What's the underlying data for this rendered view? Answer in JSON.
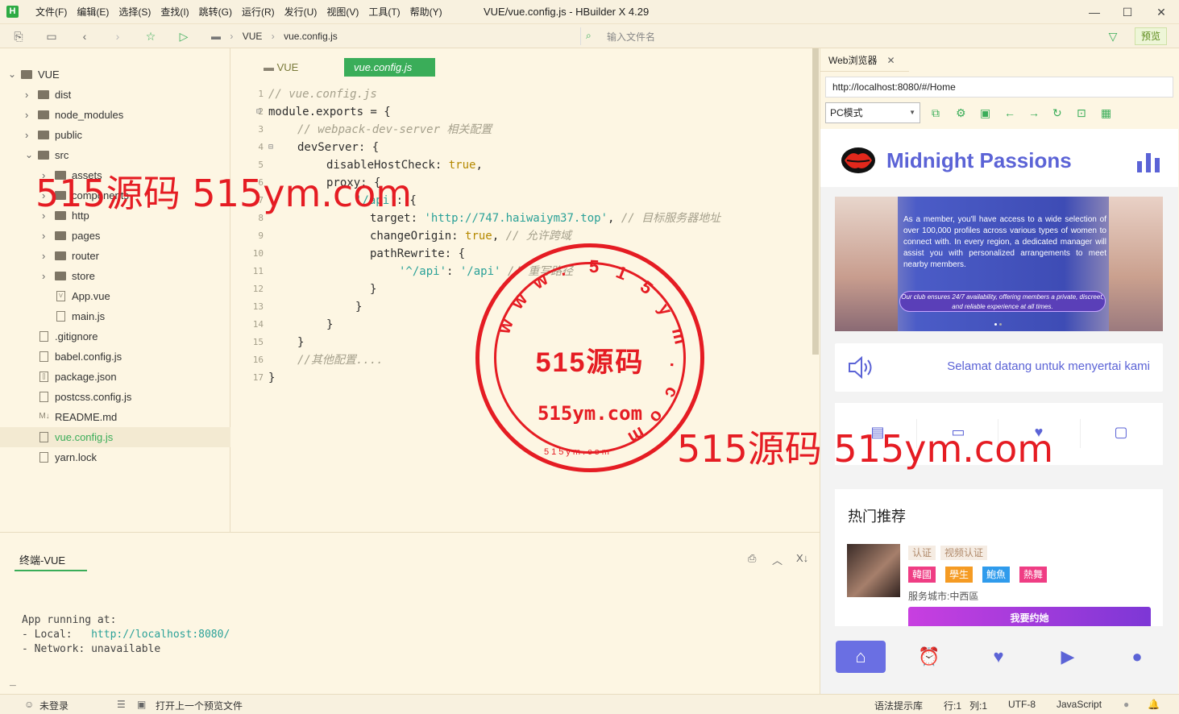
{
  "app": {
    "logo": "H",
    "window_title": "VUE/vue.config.js - HBuilder X 4.29",
    "menu": [
      "文件(F)",
      "编辑(E)",
      "选择(S)",
      "查找(I)",
      "跳转(G)",
      "运行(R)",
      "发行(U)",
      "视图(V)",
      "工具(T)",
      "帮助(Y)"
    ],
    "window_buttons": [
      "—",
      "☐",
      "✕"
    ]
  },
  "toolbar": {
    "breadcrumb": [
      "VUE",
      "vue.config.js"
    ],
    "file_search_placeholder": "输入文件名",
    "preview_label": "预览"
  },
  "sidebar": {
    "tree": [
      {
        "label": "VUE",
        "type": "folder",
        "depth": 0,
        "expanded": true
      },
      {
        "label": "dist",
        "type": "folder",
        "depth": 1
      },
      {
        "label": "node_modules",
        "type": "folder",
        "depth": 1
      },
      {
        "label": "public",
        "type": "folder",
        "depth": 1
      },
      {
        "label": "src",
        "type": "folder",
        "depth": 1,
        "expanded": true
      },
      {
        "label": "assets",
        "type": "folder",
        "depth": 2
      },
      {
        "label": "components",
        "type": "folder",
        "depth": 2
      },
      {
        "label": "http",
        "type": "folder",
        "depth": 2
      },
      {
        "label": "pages",
        "type": "folder",
        "depth": 2
      },
      {
        "label": "router",
        "type": "folder",
        "depth": 2
      },
      {
        "label": "store",
        "type": "folder",
        "depth": 2
      },
      {
        "label": "App.vue",
        "type": "file",
        "depth": 2,
        "icon": "V"
      },
      {
        "label": "main.js",
        "type": "file",
        "depth": 2,
        "icon": ""
      },
      {
        "label": ".gitignore",
        "type": "file",
        "depth": 1,
        "icon": ""
      },
      {
        "label": "babel.config.js",
        "type": "file",
        "depth": 1,
        "icon": ""
      },
      {
        "label": "package.json",
        "type": "file",
        "depth": 1,
        "icon": "[]"
      },
      {
        "label": "postcss.config.js",
        "type": "file",
        "depth": 1,
        "icon": ""
      },
      {
        "label": "README.md",
        "type": "file",
        "depth": 1,
        "icon": "M↓"
      },
      {
        "label": "vue.config.js",
        "type": "file",
        "depth": 1,
        "icon": "",
        "selected": true
      },
      {
        "label": "yarn.lock",
        "type": "file",
        "depth": 1,
        "icon": ""
      }
    ]
  },
  "editor": {
    "folder_tab": "VUE",
    "active_tab": "vue.config.js",
    "lines": [
      {
        "n": "1",
        "indent": 0,
        "parts": [
          [
            "c-com",
            "// vue.config.js"
          ]
        ]
      },
      {
        "n": "2",
        "indent": 0,
        "fold": "⊟",
        "parts": [
          [
            "c-txt",
            "module.exports = {"
          ]
        ]
      },
      {
        "n": "3",
        "indent": 1,
        "parts": [
          [
            "c-com",
            "// webpack-dev-server 相关配置"
          ]
        ]
      },
      {
        "n": "4",
        "indent": 1,
        "fold": "⊟",
        "parts": [
          [
            "c-txt",
            "devServer: {"
          ]
        ]
      },
      {
        "n": "5",
        "indent": 2,
        "parts": [
          [
            "c-txt",
            "disableHostCheck: "
          ],
          [
            "c-key",
            "true"
          ],
          [
            "c-txt",
            ","
          ]
        ]
      },
      {
        "n": "6",
        "indent": 2,
        "parts": [
          [
            "c-txt",
            "proxy: {"
          ]
        ]
      },
      {
        "n": "7",
        "indent": 3,
        "parts": [
          [
            "c-str",
            "'/api'"
          ],
          [
            "c-txt",
            ": {"
          ]
        ]
      },
      {
        "n": "8",
        "indent": 3,
        "extra": 2,
        "parts": [
          [
            "c-txt",
            "target: "
          ],
          [
            "c-str",
            "'http://747.haiwaiym37.top'"
          ],
          [
            "c-txt",
            ", "
          ],
          [
            "c-com",
            "// 目标服务器地址"
          ]
        ]
      },
      {
        "n": "9",
        "indent": 3,
        "extra": 2,
        "parts": [
          [
            "c-txt",
            "changeOrigin: "
          ],
          [
            "c-key",
            "true"
          ],
          [
            "c-txt",
            ", "
          ],
          [
            "c-com",
            "// 允许跨域"
          ]
        ]
      },
      {
        "n": "10",
        "indent": 3,
        "extra": 2,
        "parts": [
          [
            "c-txt",
            "pathRewrite: {"
          ]
        ]
      },
      {
        "n": "11",
        "indent": 4,
        "extra": 2,
        "parts": [
          [
            "c-str",
            "'^/api'"
          ],
          [
            "c-txt",
            ": "
          ],
          [
            "c-str",
            "'/api'"
          ],
          [
            "c-txt",
            " "
          ],
          [
            "c-com",
            "// 重写路径"
          ]
        ]
      },
      {
        "n": "12",
        "indent": 3,
        "extra": 2,
        "parts": [
          [
            "c-txt",
            "}"
          ]
        ]
      },
      {
        "n": "13",
        "indent": 3,
        "parts": [
          [
            "c-txt",
            "}"
          ]
        ]
      },
      {
        "n": "14",
        "indent": 2,
        "parts": [
          [
            "c-txt",
            "}"
          ]
        ]
      },
      {
        "n": "15",
        "indent": 1,
        "parts": [
          [
            "c-txt",
            "}"
          ]
        ]
      },
      {
        "n": "16",
        "indent": 1,
        "parts": [
          [
            "c-com",
            "//其他配置...."
          ]
        ]
      },
      {
        "n": "17",
        "indent": 0,
        "parts": [
          [
            "c-txt",
            "}"
          ]
        ]
      }
    ]
  },
  "terminal": {
    "tab_label": "终端-VUE",
    "line1": "App running at:",
    "line2_prefix": "- Local:   ",
    "line2_url": "http://localhost:8080/",
    "line3": "- Network: unavailable",
    "cursor": "_"
  },
  "statusbar": {
    "login": "未登录",
    "open_last": "打开上一个预览文件",
    "syntax_hint": "语法提示库",
    "position": "行:1   列:1",
    "encoding": "UTF-8",
    "language": "JavaScript"
  },
  "browser": {
    "tab_label": "Web浏览器",
    "url": "http://localhost:8080/#/Home",
    "mode": "PC模式",
    "page": {
      "brand": "Midnight Passions",
      "banner_text": "As a member, you'll have access to a wide selection of over 100,000 profiles across various types of women to connect with. In every region, a dedicated manager will assist you with personalized arrangements to meet nearby members.",
      "banner_pill": "Our club ensures 24/7 availability, offering members a private, discreet, and reliable experience at all times.",
      "notice": "Selamat datang untuk menyertai kami",
      "hot_title": "热门推荐",
      "tags_outline": [
        "认证",
        "视频认证"
      ],
      "tags": [
        {
          "label": "韓國",
          "color": "#ef3d84"
        },
        {
          "label": "學生",
          "color": "#f59b23"
        },
        {
          "label": "鮑魚",
          "color": "#2f9bec"
        },
        {
          "label": "熱舞",
          "color": "#ef3d84"
        }
      ],
      "city": "服务城市:中西區",
      "date_button": "我要约她"
    }
  },
  "watermark": {
    "text_top": "515源码 515ym.com",
    "text_bottom": "515源码 515ym.com",
    "stamp_main": "515源码",
    "stamp_url": "515ym.com",
    "stamp_small": "515ym.com",
    "stamp_ring": [
      "w",
      "w",
      "w",
      ".",
      "5",
      "1",
      "5",
      "y",
      "m",
      ".",
      "c",
      "o",
      "m"
    ]
  }
}
